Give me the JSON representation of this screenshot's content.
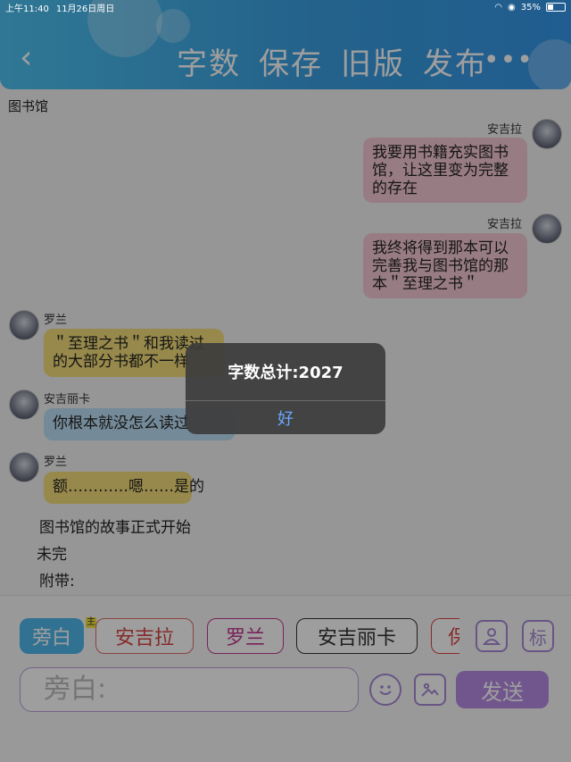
{
  "status_bar": {
    "time": "上午11:40",
    "date": "11月26日周日",
    "battery": "35%",
    "battery_level": 0.35
  },
  "header": {
    "actions": [
      "字数",
      "保存",
      "旧版",
      "发布"
    ],
    "more": "•••"
  },
  "chat": {
    "title": "图书馆",
    "messages": [
      {
        "speaker": "安吉拉",
        "text_lines": [
          "我要用书籍充实图书",
          "馆，让这里变为完整",
          "的存在"
        ]
      },
      {
        "speaker": "安吉拉",
        "text_lines": [
          "我终将得到那本可以",
          "完善我与图书馆的那",
          "本＂至理之书＂"
        ]
      },
      {
        "speaker": "罗兰",
        "text_lines": [
          "＂至理之书＂和我读过",
          "的大部分书都不一样"
        ]
      },
      {
        "speaker": "安吉丽卡",
        "text_lines": [
          "你根本就没怎么读过"
        ]
      },
      {
        "speaker": "罗兰",
        "text_lines": [
          "额…………嗯……是的"
        ]
      }
    ],
    "narration": [
      "图书馆的故事正式开始",
      "未完",
      "附带:"
    ]
  },
  "composer": {
    "characters": [
      "旁白",
      "安吉拉",
      "罗兰",
      "安吉丽卡",
      "保"
    ],
    "main_tag": "主",
    "placeholder": "旁白:",
    "send_label": "发送",
    "tag_label": "标"
  },
  "alert": {
    "title": "字数总计:2027",
    "ok_label": "好"
  },
  "colors": {
    "header_blue": "#3a9fe0",
    "pink_bubble": "#f6c9d4",
    "yellow_bubble": "#f4dd7a",
    "blue_bubble": "#bcdff5",
    "send_purple": "#b68be6",
    "alert_button": "#6aa8ff"
  }
}
